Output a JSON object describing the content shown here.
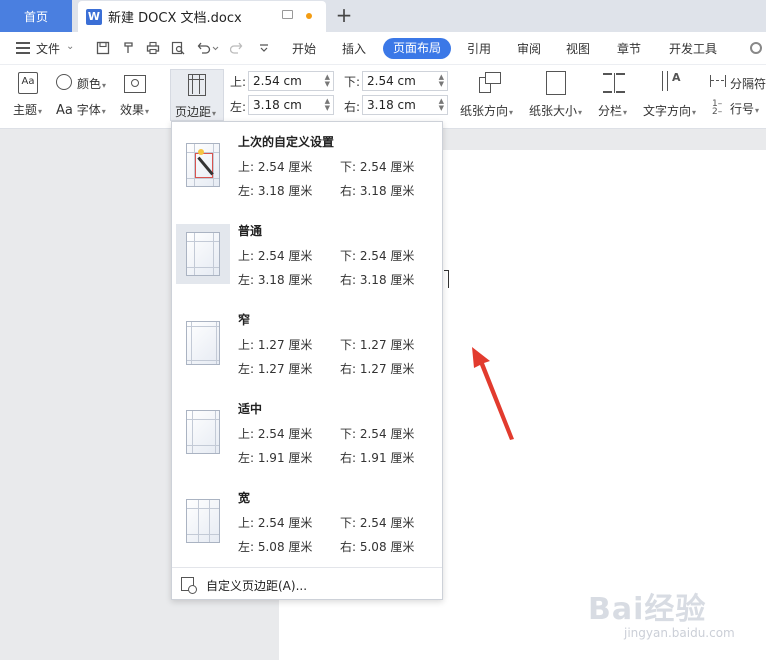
{
  "titlebar": {
    "home_tab": "首页",
    "doc_icon_letter": "W",
    "doc_name": "新建 DOCX 文档.docx",
    "add_tab": "+",
    "unsaved_dot_color": "#f39c12"
  },
  "menubar": {
    "file_label": "文件",
    "tabs": [
      "开始",
      "插入",
      "页面布局",
      "引用",
      "审阅",
      "视图",
      "章节",
      "开发工具"
    ],
    "active_tab": "页面布局",
    "accent_color": "#3b78e7"
  },
  "ribbon": {
    "theme_label": "主题",
    "color_label": "颜色",
    "font_label": "字体",
    "effect_label": "效果",
    "margin_label": "页边距",
    "margins": {
      "top_label": "上:",
      "top_value": "2.54 cm",
      "bottom_label": "下:",
      "bottom_value": "2.54 cm",
      "left_label": "左:",
      "left_value": "3.18 cm",
      "right_label": "右:",
      "right_value": "3.18 cm"
    },
    "orientation_label": "纸张方向",
    "size_label": "纸张大小",
    "columns_label": "分栏",
    "text_dir_label": "文字方向",
    "separator_label": "分隔符",
    "line_num_label": "行号"
  },
  "dropdown": {
    "presets": [
      {
        "name": "上次的自定义设置",
        "top": "上: 2.54 厘米",
        "bottom": "下: 2.54 厘米",
        "left": "左: 3.18 厘米",
        "right": "右: 3.18 厘米"
      },
      {
        "name": "普通",
        "top": "上: 2.54 厘米",
        "bottom": "下: 2.54 厘米",
        "left": "左: 3.18 厘米",
        "right": "右: 3.18 厘米"
      },
      {
        "name": "窄",
        "top": "上: 1.27 厘米",
        "bottom": "下: 1.27 厘米",
        "left": "左: 1.27 厘米",
        "right": "右: 1.27 厘米"
      },
      {
        "name": "适中",
        "top": "上: 2.54 厘米",
        "bottom": "下: 2.54 厘米",
        "left": "左: 1.91 厘米",
        "right": "右: 1.91 厘米"
      },
      {
        "name": "宽",
        "top": "上: 2.54 厘米",
        "bottom": "下: 2.54 厘米",
        "left": "左: 5.08 厘米",
        "right": "右: 5.08 厘米"
      }
    ],
    "selected_preset": "普通",
    "custom_label": "自定义页边距(A)..."
  },
  "watermark": {
    "brand": "Bai经验",
    "url": "jingyan.baidu.com"
  },
  "annotation_color": "#e23b2e"
}
